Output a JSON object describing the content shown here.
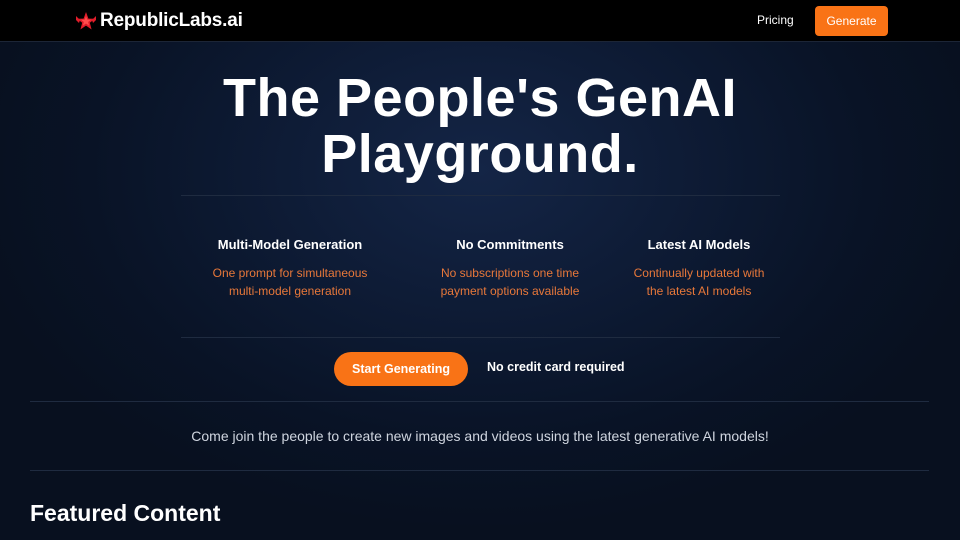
{
  "header": {
    "brand": "RepublicLabs.ai",
    "logo_icon": "star-wings-logo-icon",
    "nav_pricing": "Pricing",
    "generate_label": "Generate"
  },
  "hero": {
    "title_line1": "The People's GenAI",
    "title_line2": "Playground."
  },
  "features": [
    {
      "title": "Multi-Model Generation",
      "desc_line1": "One prompt for simultaneous",
      "desc_line2": "multi-model generation"
    },
    {
      "title": "No Commitments",
      "desc_line1": "No subscriptions one time",
      "desc_line2": "payment options available"
    },
    {
      "title": "Latest AI Models",
      "desc_line1": "Continually updated with",
      "desc_line2": "the latest AI models"
    }
  ],
  "cta": {
    "start_label": "Start Generating",
    "note": "No credit card required"
  },
  "tagline": "Come join the people to create new images and videos using the latest generative AI models!",
  "featured_heading": "Featured Content",
  "colors": {
    "accent": "#f97316",
    "feature_desc": "#e8783a",
    "header_bg": "#000000",
    "page_bg": "#0d1a33"
  }
}
